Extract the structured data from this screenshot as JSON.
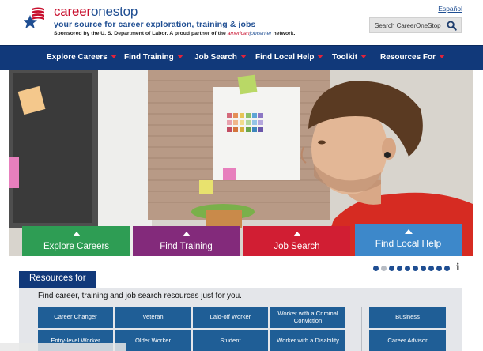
{
  "header": {
    "brand_part1": "career",
    "brand_part2": "onestop",
    "tagline": "your source for career exploration, training & jobs",
    "sponsor_prefix": "Sponsored by the U. S. Department of Labor. A proud partner of the ",
    "sponsor_ajc_1": "american",
    "sponsor_ajc_2": "jobcenter",
    "sponsor_suffix": " network.",
    "language_link": "Español",
    "search_label": "Search CareerOneStop",
    "search_icon": "magnifier-icon"
  },
  "nav": {
    "items": [
      {
        "label": "Explore Careers"
      },
      {
        "label": "Find Training"
      },
      {
        "label": "Job Search"
      },
      {
        "label": "Find Local Help"
      },
      {
        "label": "Toolkit"
      },
      {
        "label": "Resources For"
      }
    ]
  },
  "hero": {
    "tiles": [
      {
        "label": "Explore Careers",
        "color": "#2e9d54"
      },
      {
        "label": "Find Training",
        "color": "#832a7b"
      },
      {
        "label": "Job Search",
        "color": "#d11e33"
      },
      {
        "label": "Find Local Help",
        "color": "#3d88ca"
      }
    ],
    "carousel": {
      "slide_count": 10,
      "active_index": 0,
      "info_label": "i"
    }
  },
  "resources": {
    "tab_label": "Resources for",
    "intro": "Find career, training and job search resources just for you.",
    "buttons": [
      "Career Changer",
      "Veteran",
      "Laid-off Worker",
      "Worker with a Criminal Conviction",
      "Business",
      "Entry-level Worker",
      "Older Worker",
      "Student",
      "Worker with a Disability",
      "Career Advisor"
    ]
  },
  "colors": {
    "nav_bg": "#11397a",
    "brand_red": "#c8102e",
    "brand_blue": "#1f4e92",
    "resource_button": "#1f5e96"
  }
}
